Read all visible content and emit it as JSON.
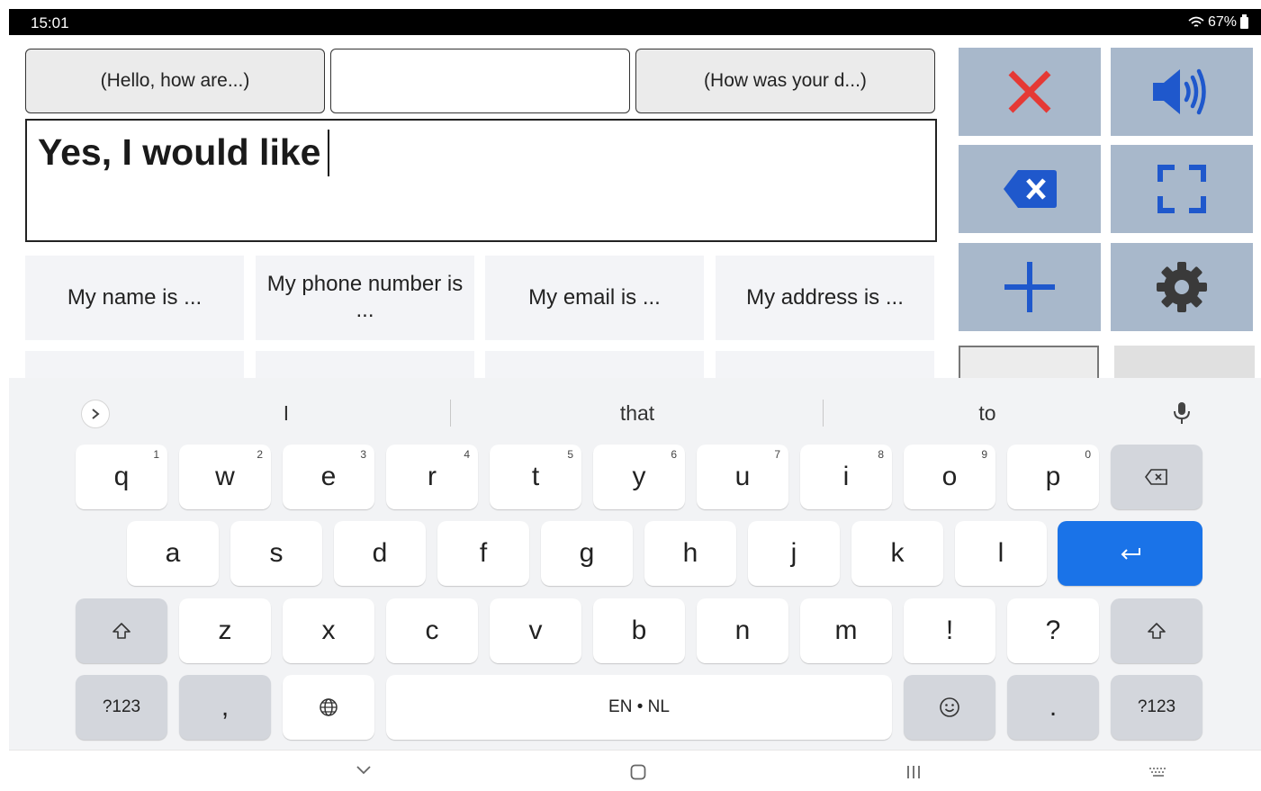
{
  "status_bar": {
    "time": "15:01",
    "battery": "67%"
  },
  "history": [
    {
      "label": "(Hello, how are...)"
    },
    {
      "label": ""
    },
    {
      "label": "(How was your d...)"
    }
  ],
  "message": {
    "text": "Yes, I would like"
  },
  "phrases": [
    {
      "label": "My name is ..."
    },
    {
      "label": "My phone number is ..."
    },
    {
      "label": "My email is ..."
    },
    {
      "label": "My address is ..."
    }
  ],
  "controls": {
    "clear": "close-icon",
    "speak": "speaker-icon",
    "backspace": "backspace-icon",
    "fullscreen": "fullscreen-icon",
    "add": "plus-icon",
    "settings": "gear-icon",
    "colors": {
      "tile": "#a8b8cb",
      "clear": "#e53935",
      "accent": "#1f58cc",
      "settings": "#3a3a3a"
    }
  },
  "keyboard": {
    "suggestions": [
      "I",
      "that",
      "to"
    ],
    "row1": [
      {
        "key": "q",
        "hint": "1"
      },
      {
        "key": "w",
        "hint": "2"
      },
      {
        "key": "e",
        "hint": "3"
      },
      {
        "key": "r",
        "hint": "4"
      },
      {
        "key": "t",
        "hint": "5"
      },
      {
        "key": "y",
        "hint": "6"
      },
      {
        "key": "u",
        "hint": "7"
      },
      {
        "key": "i",
        "hint": "8"
      },
      {
        "key": "o",
        "hint": "9"
      },
      {
        "key": "p",
        "hint": "0"
      }
    ],
    "row2": [
      "a",
      "s",
      "d",
      "f",
      "g",
      "h",
      "j",
      "k",
      "l"
    ],
    "row3": [
      "z",
      "x",
      "c",
      "v",
      "b",
      "n",
      "m",
      "!",
      "?"
    ],
    "symbols_label": "?123",
    "comma": ",",
    "space_label": "EN • NL",
    "period": ".",
    "enter_color": "#1a73e8"
  }
}
